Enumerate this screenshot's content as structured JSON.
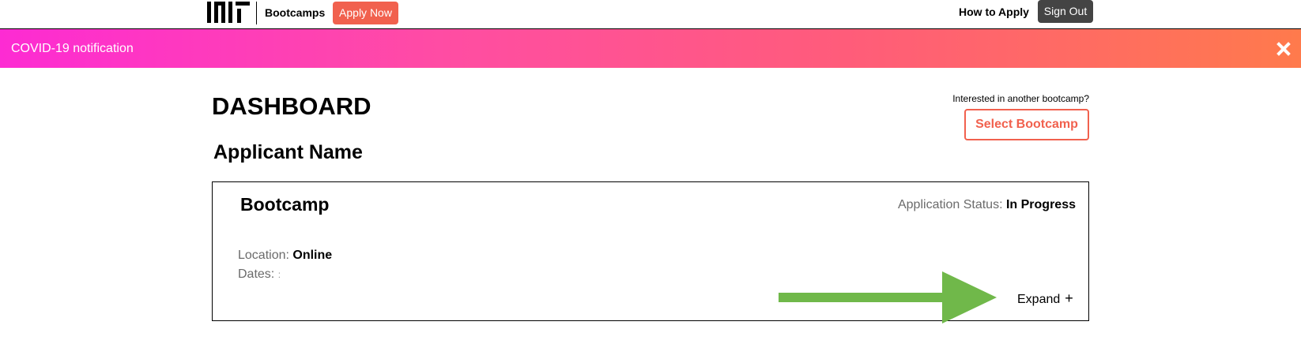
{
  "nav": {
    "logo_text": "MIT",
    "brand": "Bootcamps",
    "apply_now": "Apply Now",
    "how_to_apply": "How to Apply",
    "sign_out": "Sign Out"
  },
  "banner": {
    "text": "COVID-19 notification",
    "close_icon": "close-icon"
  },
  "main": {
    "title": "DASHBOARD",
    "applicant_name": "Applicant Name",
    "interested_text": "Interested in another bootcamp?",
    "select_bootcamp": "Select Bootcamp"
  },
  "card": {
    "title": "Bootcamp",
    "status_label": "Application Status:",
    "status_value": "In Progress",
    "location_label": "Location:",
    "location_value": "Online",
    "dates_label": "Dates:",
    "dates_value": ":",
    "expand_label": "Expand",
    "expand_icon": "plus-icon"
  },
  "colors": {
    "accent": "#f1614e",
    "sign_out_bg": "#444444",
    "banner_gradient": [
      "#fd2bd3",
      "#ff4da2",
      "#ff5c7a",
      "#ff7a4c"
    ],
    "annotation_arrow": "#70b84a",
    "muted_text": "#6b6b6b"
  }
}
